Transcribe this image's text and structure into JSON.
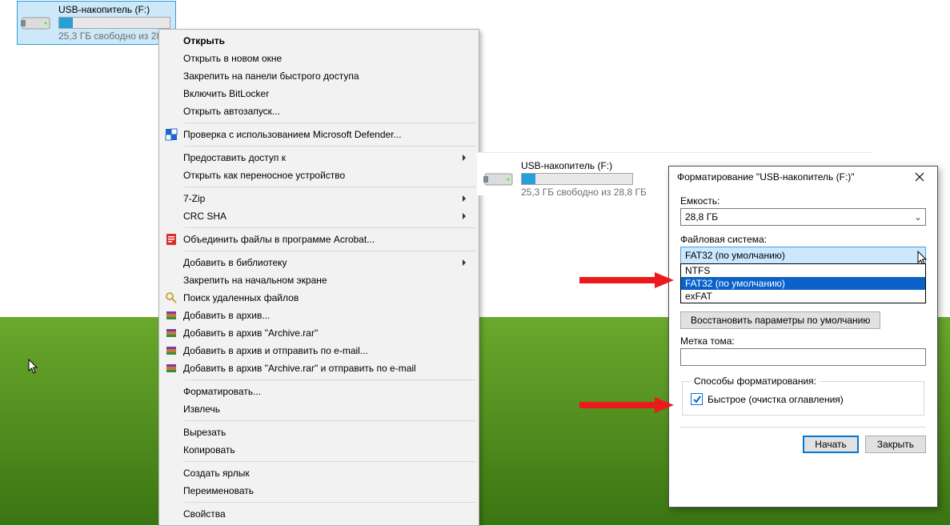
{
  "drive": {
    "name": "USB-накопитель (F:)",
    "free_text": "25,3 ГБ свободно из 28,8 ГБ",
    "free_text_cut": "25,3 ГБ свободно из 28"
  },
  "ctx": {
    "items": [
      {
        "label": "Открыть",
        "bold": true
      },
      {
        "label": "Открыть в новом окне"
      },
      {
        "label": "Закрепить на панели быстрого доступа"
      },
      {
        "label": "Включить BitLocker"
      },
      {
        "label": "Открыть автозапуск..."
      },
      {
        "sep": true
      },
      {
        "label": "Проверка с использованием Microsoft Defender...",
        "icon": "shield"
      },
      {
        "sep": true
      },
      {
        "label": "Предоставить доступ к",
        "sub": true
      },
      {
        "label": "Открыть как переносное устройство"
      },
      {
        "sep": true
      },
      {
        "label": "7-Zip",
        "sub": true
      },
      {
        "label": "CRC SHA",
        "sub": true
      },
      {
        "sep": true
      },
      {
        "label": "Объединить файлы в программе Acrobat...",
        "icon": "pdf"
      },
      {
        "sep": true
      },
      {
        "label": "Добавить в библиотеку",
        "sub": true
      },
      {
        "label": "Закрепить на начальном экране"
      },
      {
        "label": "Поиск удаленных файлов",
        "icon": "search"
      },
      {
        "label": "Добавить в архив...",
        "icon": "rar"
      },
      {
        "label": "Добавить в архив \"Archive.rar\"",
        "icon": "rar"
      },
      {
        "label": "Добавить в архив и отправить по e-mail...",
        "icon": "rar"
      },
      {
        "label": "Добавить в архив \"Archive.rar\" и отправить по e-mail",
        "icon": "rar"
      },
      {
        "sep": true
      },
      {
        "label": "Форматировать..."
      },
      {
        "label": "Извлечь"
      },
      {
        "sep": true
      },
      {
        "label": "Вырезать"
      },
      {
        "label": "Копировать"
      },
      {
        "sep": true
      },
      {
        "label": "Создать ярлык"
      },
      {
        "label": "Переименовать"
      },
      {
        "sep": true
      },
      {
        "label": "Свойства"
      }
    ]
  },
  "dlg": {
    "title": "Форматирование \"USB-накопитель (F:)\"",
    "capacity_label": "Емкость:",
    "capacity_value": "28,8 ГБ",
    "fs_label": "Файловая система:",
    "fs_value": "FAT32 (по умолчанию)",
    "fs_options": [
      "NTFS",
      "FAT32 (по умолчанию)",
      "exFAT"
    ],
    "restore_btn": "Восстановить параметры по умолчанию",
    "volume_label": "Метка тома:",
    "volume_value": "",
    "methods_label": "Способы форматирования:",
    "quick_label": "Быстрое (очистка оглавления)",
    "quick_checked": true,
    "start_btn": "Начать",
    "close_btn": "Закрыть"
  }
}
